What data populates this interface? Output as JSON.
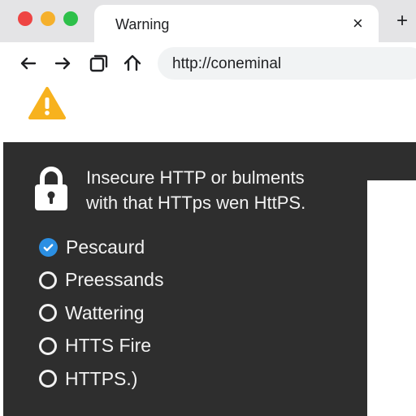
{
  "window": {
    "traffic_lights": {
      "close": "#ee4443",
      "minimize": "#f5b02c",
      "zoom": "#2dc04a"
    }
  },
  "tab": {
    "title": "Warning",
    "close_label": "×",
    "new_tab_label": "+"
  },
  "toolbar": {
    "icons": [
      "back-arrow-icon",
      "forward-arrow-icon",
      "tab-overview-icon",
      "home-icon"
    ],
    "address": "http://coneminal"
  },
  "page": {
    "warning_icon_color": "#f7b21e",
    "message_line1": "Insecure HTTP or bulments",
    "message_line2": "with that HTTps wen HttPS.",
    "options": [
      {
        "label": "Pescaurd",
        "checked": true
      },
      {
        "label": "Preessands",
        "checked": false
      },
      {
        "label": "Wattering",
        "checked": false
      },
      {
        "label": "HTTS Fire",
        "checked": false
      },
      {
        "label": "HTTPS.)",
        "checked": false
      }
    ],
    "accent_color": "#2b8fe3",
    "panel_color": "#2e2e2e"
  }
}
